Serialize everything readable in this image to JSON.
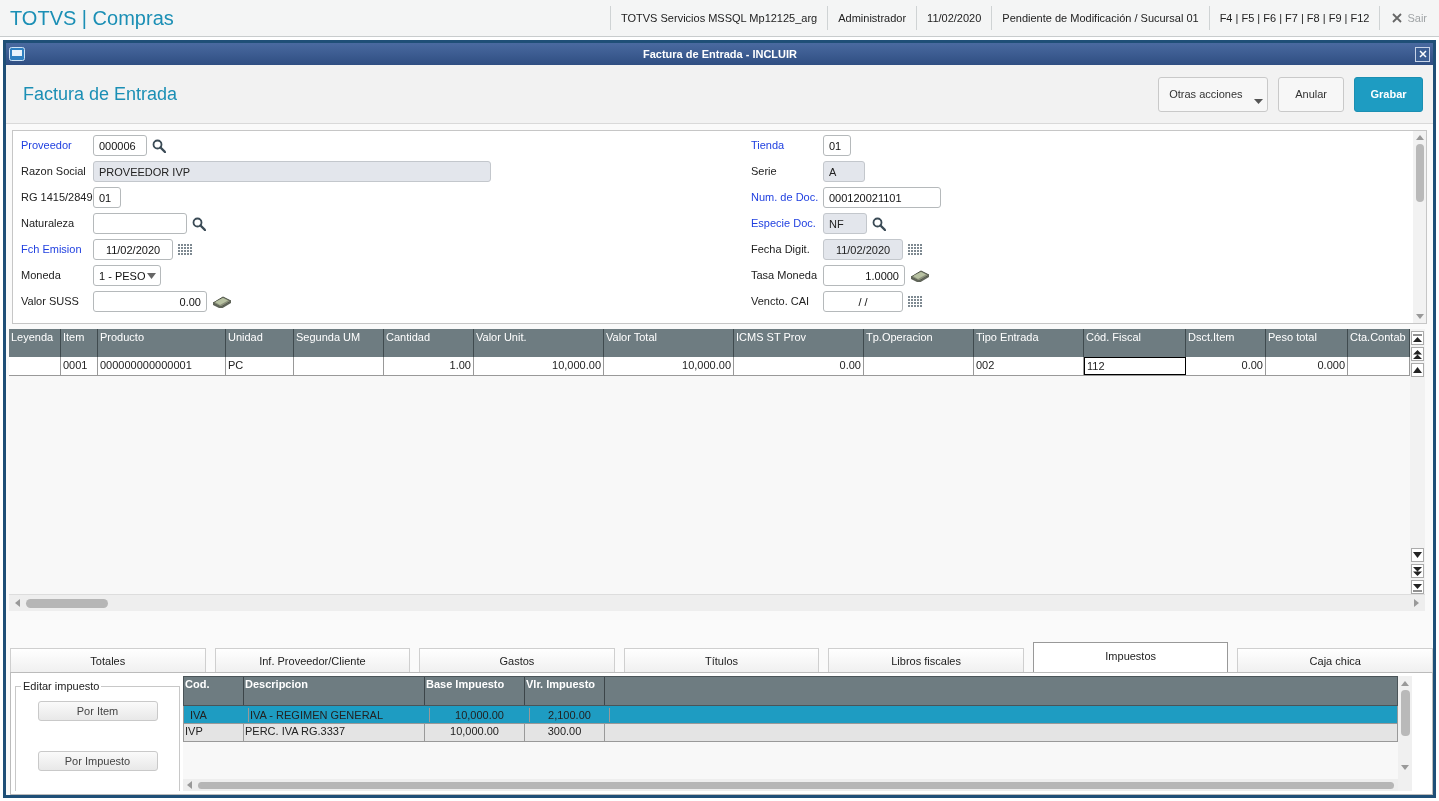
{
  "app_bar": {
    "logo": "TOTVS | Compras",
    "items": [
      "TOTVS Servicios MSSQL Mp12125_arg",
      "Administrador",
      "11/02/2020",
      "Pendiente de Modificación / Sucursal 01",
      "F4 | F5 | F6 | F7 | F8 | F9 | F12"
    ],
    "exit": {
      "label": "Sair",
      "disabled": true
    }
  },
  "window": {
    "title": "Factura de Entrada - INCLUIR"
  },
  "header": {
    "title": "Factura de Entrada",
    "buttons": [
      {
        "label": "Otras acciones",
        "kind": "menu"
      },
      {
        "label": "Anular",
        "kind": "plain"
      },
      {
        "label": "Grabar",
        "kind": "primary"
      }
    ]
  },
  "form": {
    "left": [
      {
        "label": "Proveedor",
        "required": true,
        "value": "000006",
        "kind": "lookup",
        "readonly": false
      },
      {
        "label": "Razon Social",
        "required": false,
        "value": "PROVEEDOR IVP",
        "kind": "text",
        "readonly": true
      },
      {
        "label": "RG 1415/2849",
        "required": false,
        "value": "01",
        "kind": "text",
        "readonly": false
      },
      {
        "label": "Naturaleza",
        "required": false,
        "kind": "lookup",
        "readonly": false
      },
      {
        "label": "Fch Emision",
        "required": true,
        "value": "11/02/2020",
        "kind": "date",
        "readonly": false
      },
      {
        "label": "Moneda",
        "required": false,
        "value": "1 - PESO",
        "kind": "select",
        "readonly": false
      },
      {
        "label": "Valor SUSS",
        "required": false,
        "value": "0.00",
        "kind": "money",
        "readonly": false
      }
    ],
    "right": [
      {
        "label": "Tienda",
        "required": true,
        "value": "01",
        "kind": "text",
        "readonly": false
      },
      {
        "label": "Serie",
        "required": false,
        "value": "A",
        "kind": "text",
        "readonly": true
      },
      {
        "label": "Num. de Doc.",
        "required": true,
        "value": "000120021101",
        "kind": "text",
        "readonly": false
      },
      {
        "label": "Especie Doc.",
        "required": true,
        "value": "NF",
        "kind": "lookup",
        "readonly": true
      },
      {
        "label": "Fecha Digit.",
        "required": false,
        "value": "11/02/2020",
        "kind": "date",
        "readonly": true
      },
      {
        "label": "Tasa Moneda",
        "required": false,
        "value": "1.0000",
        "kind": "money",
        "readonly": false
      },
      {
        "label": "Vencto. CAI",
        "required": false,
        "value": "/ /",
        "kind": "date",
        "readonly": false
      }
    ]
  },
  "items_table": {
    "columns": [
      {
        "label": "Leyenda",
        "kind": "text"
      },
      {
        "label": "Item",
        "kind": "text"
      },
      {
        "label": "Producto",
        "kind": "text"
      },
      {
        "label": "Unidad",
        "kind": "text"
      },
      {
        "label": "Segunda UM",
        "kind": "text"
      },
      {
        "label": "Cantidad",
        "kind": "number"
      },
      {
        "label": "Valor Unit.",
        "kind": "number"
      },
      {
        "label": "Valor Total",
        "kind": "number"
      },
      {
        "label": "ICMS ST Prov",
        "kind": "number"
      },
      {
        "label": "Tp.Operacion",
        "kind": "text"
      },
      {
        "label": "Tipo Entrada",
        "kind": "text"
      },
      {
        "label": "Cód. Fiscal",
        "kind": "text"
      },
      {
        "label": "Dsct.Item",
        "kind": "number"
      },
      {
        "label": "Peso total",
        "kind": "number"
      },
      {
        "label": "Cta.Contab",
        "kind": "text"
      }
    ],
    "rows": [
      {
        "selected": false,
        "cells": [
          {
            "focused": false
          },
          {
            "text": "0001",
            "focused": false
          },
          {
            "text": "000000000000001",
            "focused": false
          },
          {
            "text": "PC",
            "focused": false
          },
          {
            "focused": false
          },
          {
            "text": "1.00",
            "focused": false
          },
          {
            "text": "10,000.00",
            "focused": false
          },
          {
            "text": "10,000.00",
            "focused": false
          },
          {
            "text": "0.00",
            "focused": false
          },
          {
            "focused": false
          },
          {
            "text": "002",
            "focused": false
          },
          {
            "text": "112",
            "focused": true
          },
          {
            "text": "0.00",
            "focused": false
          },
          {
            "text": "0.000",
            "focused": false
          },
          {
            "focused": false
          }
        ]
      }
    ]
  },
  "tabs": [
    {
      "label": "Totales",
      "selected": false
    },
    {
      "label": "Inf. Proveedor/Cliente",
      "selected": false
    },
    {
      "label": "Gastos",
      "selected": false
    },
    {
      "label": "Títulos",
      "selected": false
    },
    {
      "label": "Libros fiscales",
      "selected": false
    },
    {
      "label": "Impuestos",
      "selected": true
    },
    {
      "label": "Caja chica",
      "selected": false
    }
  ],
  "tax_panel": {
    "group_title": "Editar impuesto",
    "buttons": [
      "Por Item",
      "Por Impuesto"
    ],
    "columns": [
      {
        "label": "Cod.",
        "kind": "text"
      },
      {
        "label": "Descripcion",
        "kind": "text"
      },
      {
        "label": "Base Impuesto",
        "kind": "number"
      },
      {
        "label": "Vlr. Impuesto",
        "kind": "number"
      }
    ],
    "rows": [
      {
        "selected": true,
        "cells": [
          "IVA",
          "IVA - REGIMEN GENERAL",
          "10,000.00",
          "2,100.00"
        ]
      },
      {
        "selected": false,
        "cells": [
          "IVP",
          "PERC. IVA RG.3337",
          "10,000.00",
          "300.00"
        ]
      }
    ]
  }
}
